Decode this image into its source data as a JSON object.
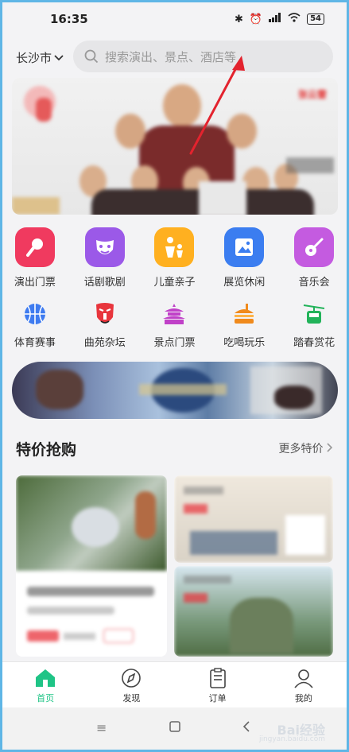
{
  "status_bar": {
    "time": "16:35",
    "battery": "54"
  },
  "header": {
    "city": "长沙市",
    "search_placeholder": "搜索演出、景点、酒店等"
  },
  "banner": {
    "badge": "张云雷"
  },
  "categories_primary": [
    {
      "label": "演出门票",
      "icon": "microphone-icon",
      "color": "#f03a5f"
    },
    {
      "label": "话剧歌剧",
      "icon": "mask-icon",
      "color": "#9b59e8"
    },
    {
      "label": "儿童亲子",
      "icon": "parent-child-icon",
      "color": "#ffb020"
    },
    {
      "label": "展览休闲",
      "icon": "picture-icon",
      "color": "#3b7df0"
    },
    {
      "label": "音乐会",
      "icon": "guitar-icon",
      "color": "#c45be0"
    }
  ],
  "categories_secondary": [
    {
      "label": "体育赛事",
      "icon": "basketball-icon",
      "color": "#3e7bf0"
    },
    {
      "label": "曲苑杂坛",
      "icon": "opera-mask-icon",
      "color": "#e8353d"
    },
    {
      "label": "景点门票",
      "icon": "temple-icon",
      "color": "#c040c8"
    },
    {
      "label": "吃喝玩乐",
      "icon": "burger-icon",
      "color": "#f08a1c"
    },
    {
      "label": "踏春赏花",
      "icon": "cable-car-icon",
      "color": "#22b35a"
    }
  ],
  "deals": {
    "title": "特价抢购",
    "more": "更多特价"
  },
  "tabbar": [
    {
      "label": "首页",
      "icon": "home-icon",
      "active": true
    },
    {
      "label": "发现",
      "icon": "compass-icon",
      "active": false
    },
    {
      "label": "订单",
      "icon": "order-icon",
      "active": false
    },
    {
      "label": "我的",
      "icon": "profile-icon",
      "active": false
    }
  ],
  "watermark": {
    "brand": "Bai经验",
    "url": "jingyan.baidu.com"
  },
  "colors": {
    "accent": "#1fc486",
    "annotation": "#e3232e"
  }
}
